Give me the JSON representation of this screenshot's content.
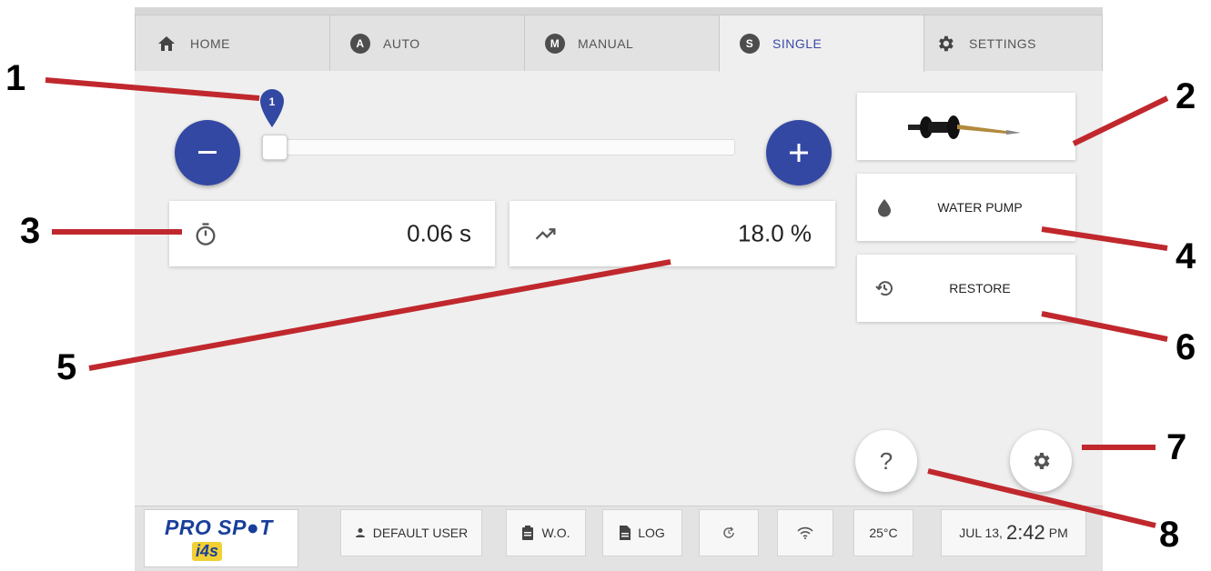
{
  "tabs": [
    {
      "label": "HOME",
      "icon": "home-icon"
    },
    {
      "label": "AUTO",
      "badge": "A"
    },
    {
      "label": "MANUAL",
      "badge": "M"
    },
    {
      "label": "SINGLE",
      "badge": "S",
      "active": true
    },
    {
      "label": "SETTINGS",
      "icon": "gear-icon"
    }
  ],
  "slider": {
    "value": "1",
    "level": 0.0
  },
  "cards": {
    "time": "0.06 s",
    "power": "18.0 %"
  },
  "side_buttons": {
    "water_pump": "WATER PUMP",
    "restore": "RESTORE"
  },
  "fab": {
    "help": "?"
  },
  "bottom_bar": {
    "logo_main": "PRO SP●T",
    "logo_sub": "i4s",
    "user": "DEFAULT USER",
    "wo": "W.O.",
    "log": "LOG",
    "temperature": "25°C",
    "date": "JUL 13,",
    "time": "2:42",
    "ampm": "PM"
  },
  "callouts": [
    "1",
    "2",
    "3",
    "4",
    "5",
    "6",
    "7",
    "8"
  ],
  "colors": {
    "accent": "#3348a3",
    "active_tab_text": "#3b4aa8",
    "callout_line": "#c0282d",
    "logo": "#1a3f9a",
    "logo_accent": "#f2d033"
  }
}
